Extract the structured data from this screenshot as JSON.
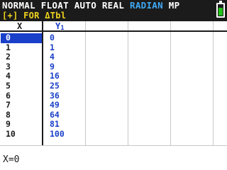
{
  "status": {
    "mode_prefix": "NORMAL FLOAT AUTO REAL ",
    "angle_mode": "RADIAN",
    "mode_suffix": " MP",
    "line2": "[+] FOR ΔTbl",
    "battery_level": 0.75
  },
  "table": {
    "col_x_header": "X",
    "col_y_header": "Y",
    "col_y_sub": "1",
    "selected_row": 0,
    "rows": [
      {
        "x": "0",
        "y": "0"
      },
      {
        "x": "1",
        "y": "1"
      },
      {
        "x": "2",
        "y": "4"
      },
      {
        "x": "3",
        "y": "9"
      },
      {
        "x": "4",
        "y": "16"
      },
      {
        "x": "5",
        "y": "25"
      },
      {
        "x": "6",
        "y": "36"
      },
      {
        "x": "7",
        "y": "49"
      },
      {
        "x": "8",
        "y": "64"
      },
      {
        "x": "9",
        "y": "81"
      },
      {
        "x": "10",
        "y": "100"
      }
    ]
  },
  "entry_line": "X=0",
  "colors": {
    "status_bg": "#1b1b1b",
    "angle_highlight": "#3fa9f5",
    "line2_text": "#f0d31c",
    "y_values": "#1a3fc9",
    "selection": "#1a3fc9",
    "battery": "#22c21a"
  }
}
